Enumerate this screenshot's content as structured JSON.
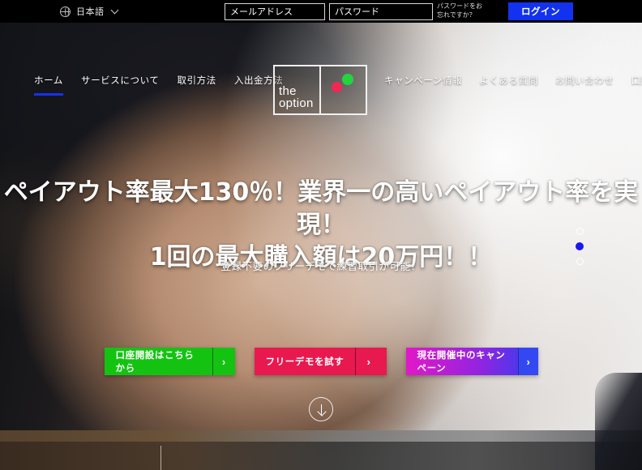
{
  "topbar": {
    "globe_icon": "globe-icon",
    "language": "日本語",
    "chevron_icon": "chevron-down-icon",
    "email_placeholder": "メールアドレス",
    "email_value": "",
    "password_placeholder": "パスワード",
    "password_value": "",
    "forgot_password": "パスワードをお忘れですか？",
    "login_label": "ログイン",
    "login_button_color": "#1332f0"
  },
  "logo": {
    "line1": "the",
    "line2": "option",
    "dot_red_color": "#ef2952",
    "dot_green_color": "#24d43f"
  },
  "nav": {
    "left": [
      {
        "label": "ホーム",
        "active": true
      },
      {
        "label": "サービスについて",
        "active": false
      },
      {
        "label": "取引方法",
        "active": false
      },
      {
        "label": "入出金方法",
        "active": false
      }
    ],
    "right": [
      {
        "label": "キャンペーン情報"
      },
      {
        "label": "よくある質問"
      },
      {
        "label": "お問い合わせ"
      },
      {
        "label": "口座開設"
      }
    ],
    "active_underline_color": "#1332f0"
  },
  "hero": {
    "headline_line1": "ペイアウト率最大130％！業界一の高いペイアウト率を実現！",
    "headline_line2": "1回の最大購入額は20万円！！",
    "subheadline": "登録不要のフリーデモで練習取引が可能！",
    "scroll_icon": "arrow-down-circle-icon"
  },
  "cta_buttons": [
    {
      "label": "口座開設はこちらから",
      "arrow": "›",
      "color": "#14c312"
    },
    {
      "label": "フリーデモを試す",
      "arrow": "›",
      "color": "#e8194f"
    },
    {
      "label": "現在開催中のキャンペーン",
      "arrow": "›",
      "color": "#e218c8"
    }
  ],
  "slider": {
    "dots": [
      {
        "active": false
      },
      {
        "active": true
      },
      {
        "active": false
      }
    ],
    "active_color": "#1a17f0"
  }
}
